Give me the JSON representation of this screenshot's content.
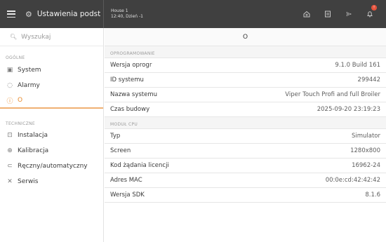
{
  "header": {
    "app_title": "Ustawienia podst",
    "house_line1": "House 1",
    "house_line2": "12:40, Dzień -1",
    "notification_count": "!"
  },
  "sidebar": {
    "search_placeholder": "Wyszukaj",
    "sections": [
      {
        "label": "OGÓLNE",
        "items": [
          {
            "label": "System",
            "icon": "system-icon"
          },
          {
            "label": "Alarmy",
            "icon": "bell-icon"
          },
          {
            "label": "O",
            "icon": "info-icon",
            "active": true
          }
        ]
      },
      {
        "label": "TECHNICZNE",
        "items": [
          {
            "label": "Instalacja",
            "icon": "installation-icon"
          },
          {
            "label": "Kalibracja",
            "icon": "calibration-icon"
          },
          {
            "label": "Ręczny/automatyczny",
            "icon": "manual-auto-icon"
          },
          {
            "label": "Serwis",
            "icon": "tools-icon"
          }
        ]
      }
    ]
  },
  "main": {
    "title": "O",
    "groups": [
      {
        "label": "OPROGRAMOWANIE",
        "rows": [
          {
            "key": "Wersja oprogr",
            "value": "9.1.0 Build 161"
          },
          {
            "key": "ID systemu",
            "value": "299442"
          },
          {
            "key": "Nazwa systemu",
            "value": "Viper Touch Profi and full Broiler"
          },
          {
            "key": "Czas budowy",
            "value": "2025-09-20 23:19:23"
          }
        ]
      },
      {
        "label": "MODUŁ CPU",
        "rows": [
          {
            "key": "Typ",
            "value": "Simulator"
          },
          {
            "key": "Screen",
            "value": "1280x800"
          },
          {
            "key": "Kod żądania licencji",
            "value": "16962-24"
          },
          {
            "key": "Adres MAC",
            "value": "00:0e:cd:42:42:42"
          },
          {
            "key": "Wersja SDK",
            "value": "8.1.6"
          }
        ]
      }
    ]
  },
  "colors": {
    "accent": "#e88a2c",
    "topbar": "#404040"
  }
}
